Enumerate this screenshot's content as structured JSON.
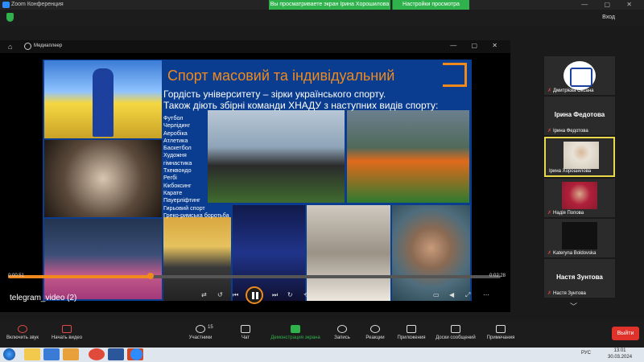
{
  "window": {
    "title": "Zoom Конференция",
    "share_banner": "Вы просматриваете экран Ірина Хорошилова",
    "view_options": "Настройки просмотра",
    "controls": "— ▢ ✕"
  },
  "topbar": {
    "login": "Вход"
  },
  "player": {
    "header_title": "Медиаплеер",
    "video_name": "telegram_video (2)",
    "time_current": "0:00:51",
    "time_total": "0:02:28",
    "progress": 0.29
  },
  "slide": {
    "title": "Спорт масовий та індивідуальний",
    "sub1": "Гордість університету – зірки українського спорту.",
    "sub2": "Також діють збірні команди ХНАДУ з наступних видів спорту:",
    "sports": [
      "Футбол",
      "Черлідинг",
      "Аеробіка",
      "Атлетика",
      "Баскетбол",
      "Художня",
      "гімнастика",
      "Тхеквондо",
      "Регбі",
      "Кікбоксинг",
      "Карате",
      "Пауерліфтинг",
      "Гирьовий спорт",
      "Греко-римська боротьба"
    ]
  },
  "participants": [
    {
      "name": "Дмитрієва Оксана",
      "type": "logo",
      "muted": true
    },
    {
      "name": "Ірина Федотова",
      "type": "name",
      "muted": true,
      "big": "Ірина Федотова"
    },
    {
      "name": "Ірина Хорошилова",
      "type": "cam",
      "muted": false,
      "active": true
    },
    {
      "name": "Надія Попова",
      "type": "cam",
      "muted": true
    },
    {
      "name": "Kateryna Boldovska",
      "type": "black",
      "muted": true
    },
    {
      "name": "Настя Зунтова",
      "type": "name",
      "muted": true,
      "big": "Настя Зунтова"
    }
  ],
  "toolbar": {
    "audio": "Включить звук",
    "video": "Начать видео",
    "participants": "Участники",
    "participants_count": "15",
    "chat": "Чат",
    "share": "Демонстрация экрана",
    "record": "Запись",
    "reactions": "Реакции",
    "apps": "Приложения",
    "whiteboards": "Доски сообщений",
    "notes": "Примечания",
    "leave": "Выйти"
  },
  "taskbar": {
    "lang": "РУС",
    "time": "13:01",
    "date": "30.03.2024"
  },
  "colors": {
    "accent": "#f08a1c",
    "green": "#2fb24c",
    "red": "#e0322a"
  }
}
